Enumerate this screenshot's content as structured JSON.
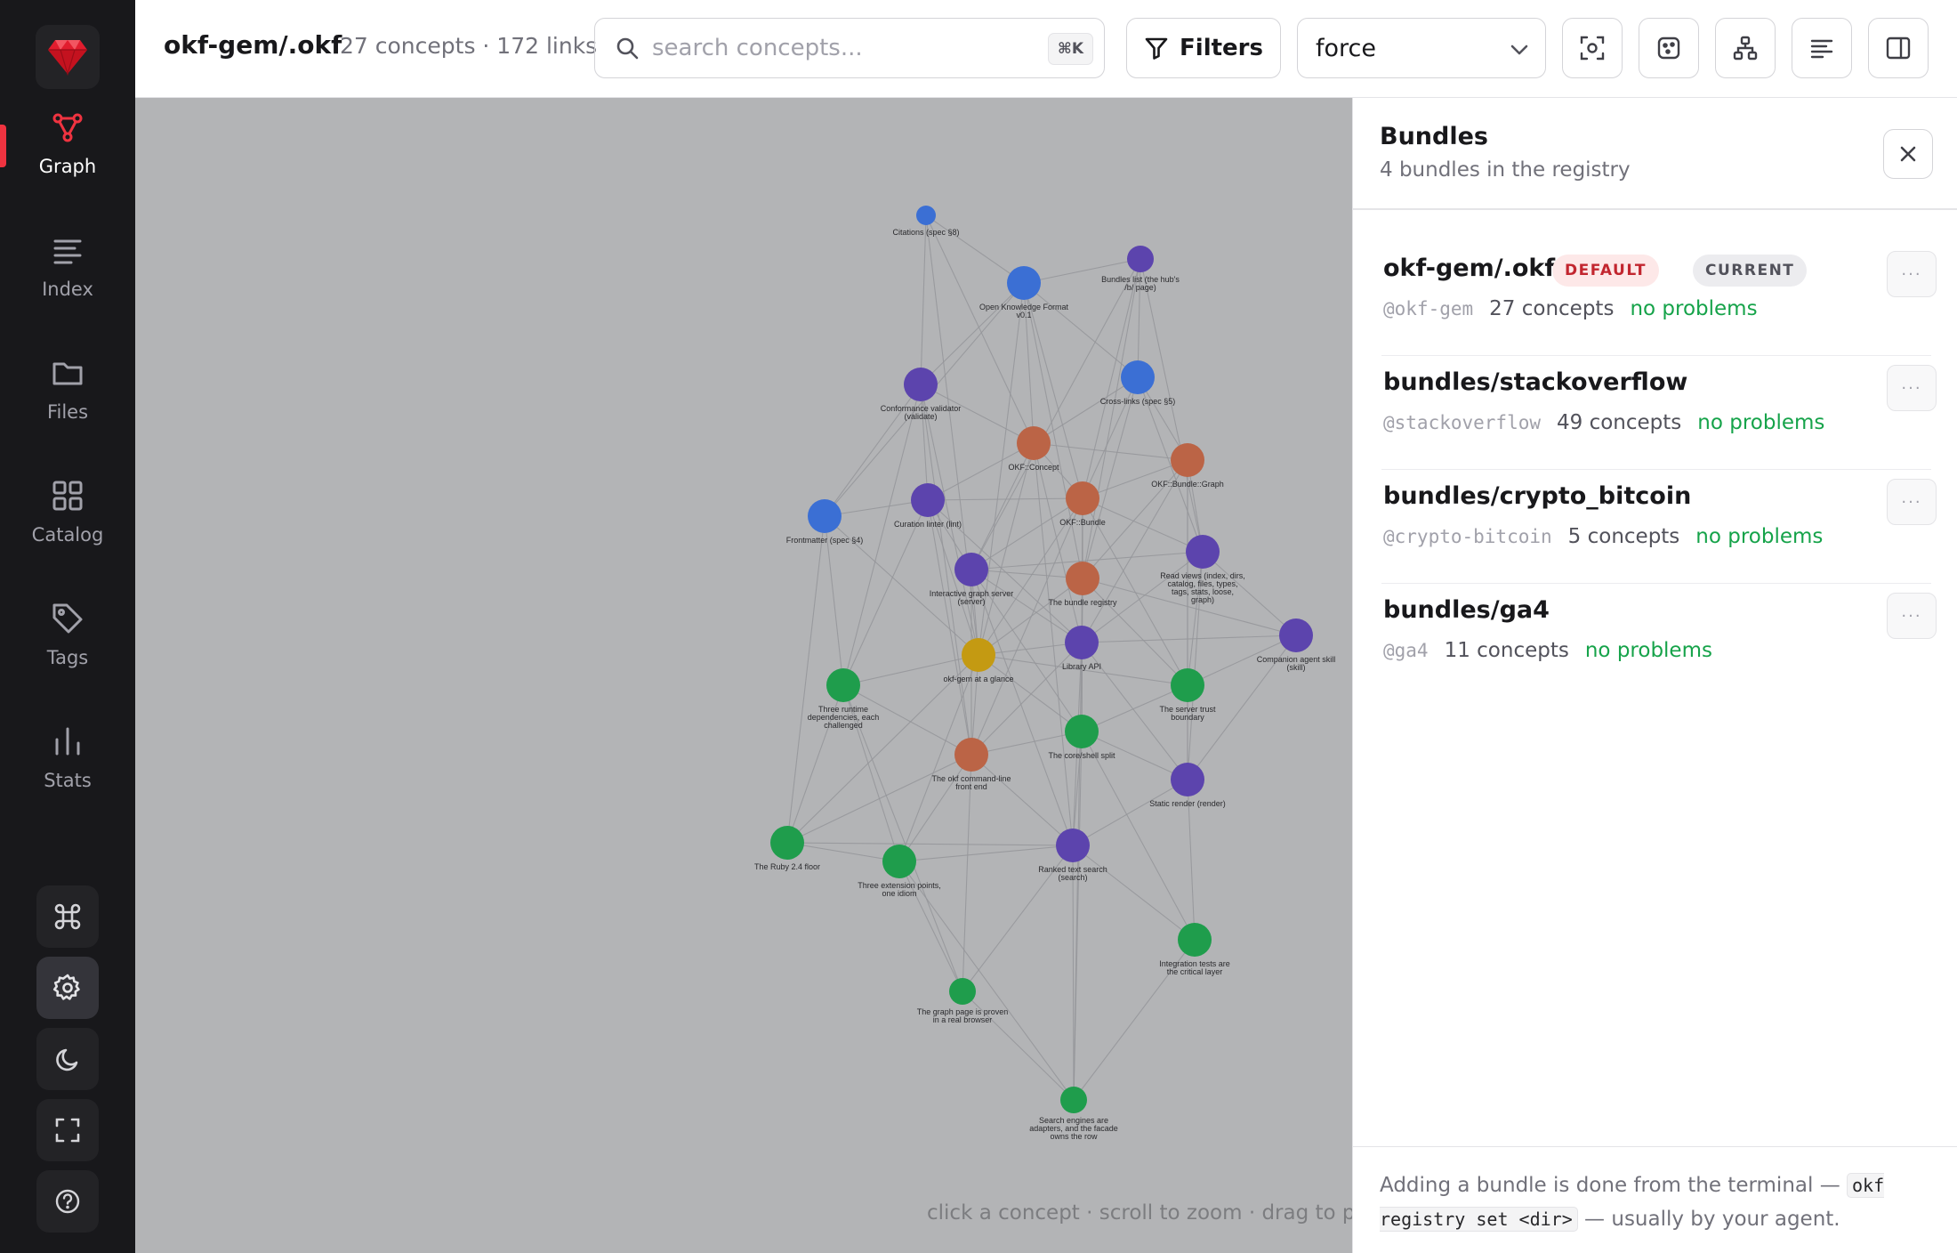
{
  "sidebar": {
    "logo_icon": "gem-icon",
    "nav": [
      {
        "label": "Graph",
        "icon": "graph-icon",
        "active": true
      },
      {
        "label": "Index",
        "icon": "list-icon"
      },
      {
        "label": "Files",
        "icon": "folder-icon"
      },
      {
        "label": "Catalog",
        "icon": "grid-icon"
      },
      {
        "label": "Tags",
        "icon": "tag-icon"
      },
      {
        "label": "Stats",
        "icon": "bar-chart-icon"
      }
    ],
    "tools": [
      {
        "icon": "command-icon"
      },
      {
        "icon": "gear-icon"
      },
      {
        "icon": "moon-icon"
      },
      {
        "icon": "fullscreen-icon"
      },
      {
        "icon": "help-icon"
      }
    ]
  },
  "header": {
    "title": "okf-gem/.okf",
    "stats": "27 concepts · 172 links",
    "search_placeholder": "search concepts...",
    "search_shortcut": "⌘K",
    "filters_label": "Filters",
    "layout_value": "force"
  },
  "graph": {
    "hint": "click a concept · scroll to zoom · drag to pan",
    "colors": {
      "blue": "#3b6fd4",
      "purple": "#5c44ad",
      "orange": "#bb6446",
      "green": "#1f9d4c",
      "yellow": "#c49a12"
    },
    "nodes": [
      {
        "id": 0,
        "label": "Citations (spec §8)",
        "color": "blue",
        "size": "s"
      },
      {
        "id": 1,
        "label": "Open Knowledge Format v0.1",
        "color": "blue",
        "size": "l"
      },
      {
        "id": 2,
        "label": "Bundles list (the hub's /b/ page)",
        "color": "purple",
        "size": "m"
      },
      {
        "id": 3,
        "label": "Conformance validator (validate)",
        "color": "purple",
        "size": "l"
      },
      {
        "id": 4,
        "label": "Cross-links (spec §5)",
        "color": "blue",
        "size": "l"
      },
      {
        "id": 5,
        "label": "OKF::Concept",
        "color": "orange",
        "size": "l"
      },
      {
        "id": 6,
        "label": "OKF::Bundle::Graph",
        "color": "orange",
        "size": "l"
      },
      {
        "id": 7,
        "label": "Frontmatter (spec §4)",
        "color": "blue",
        "size": "l"
      },
      {
        "id": 8,
        "label": "Curation linter (lint)",
        "color": "purple",
        "size": "l"
      },
      {
        "id": 9,
        "label": "OKF::Bundle",
        "color": "orange",
        "size": "l"
      },
      {
        "id": 10,
        "label": "Read views (index, dirs, catalog, files, types, tags, stats, loose, graph)",
        "color": "purple",
        "size": "l"
      },
      {
        "id": 11,
        "label": "Interactive graph server (server)",
        "color": "purple",
        "size": "l"
      },
      {
        "id": 12,
        "label": "The bundle registry",
        "color": "orange",
        "size": "l"
      },
      {
        "id": 13,
        "label": "Companion agent skill (skill)",
        "color": "purple",
        "size": "l"
      },
      {
        "id": 14,
        "label": "okf-gem at a glance",
        "color": "yellow",
        "size": "l"
      },
      {
        "id": 15,
        "label": "Library API",
        "color": "purple",
        "size": "l"
      },
      {
        "id": 16,
        "label": "Three runtime dependencies, each challenged",
        "color": "green",
        "size": "l"
      },
      {
        "id": 17,
        "label": "The server trust boundary",
        "color": "green",
        "size": "l"
      },
      {
        "id": 18,
        "label": "The core/shell split",
        "color": "green",
        "size": "l"
      },
      {
        "id": 19,
        "label": "The okf command-line front end",
        "color": "orange",
        "size": "l"
      },
      {
        "id": 20,
        "label": "Static render (render)",
        "color": "purple",
        "size": "l"
      },
      {
        "id": 21,
        "label": "The Ruby 2.4 floor",
        "color": "green",
        "size": "l"
      },
      {
        "id": 22,
        "label": "Three extension points, one idiom",
        "color": "green",
        "size": "l"
      },
      {
        "id": 23,
        "label": "Ranked text search (search)",
        "color": "purple",
        "size": "l"
      },
      {
        "id": 24,
        "label": "Integration tests are the critical layer",
        "color": "green",
        "size": "l"
      },
      {
        "id": 25,
        "label": "The graph page is proven in a real browser",
        "color": "green",
        "size": "m"
      },
      {
        "id": 26,
        "label": "Search engines are adapters, and the facade owns the row",
        "color": "green",
        "size": "m"
      }
    ]
  },
  "panel": {
    "title": "Bundles",
    "subtitle": "4 bundles in the registry",
    "bundles": [
      {
        "name": "okf-gem/.okf",
        "badges": [
          "DEFAULT",
          "CURRENT"
        ],
        "alias": "@okf-gem",
        "count": "27 concepts",
        "status": "no problems"
      },
      {
        "name": "bundles/stackoverflow",
        "badges": [],
        "alias": "@stackoverflow",
        "count": "49 concepts",
        "status": "no problems"
      },
      {
        "name": "bundles/crypto_bitcoin",
        "badges": [],
        "alias": "@crypto-bitcoin",
        "count": "5 concepts",
        "status": "no problems"
      },
      {
        "name": "bundles/ga4",
        "badges": [],
        "alias": "@ga4",
        "count": "11 concepts",
        "status": "no problems"
      }
    ],
    "footer_pre": "Adding a bundle is done from the terminal — ",
    "footer_code": "okf registry set <dir>",
    "footer_post": " — usually by your agent.",
    "more_label": "···"
  }
}
